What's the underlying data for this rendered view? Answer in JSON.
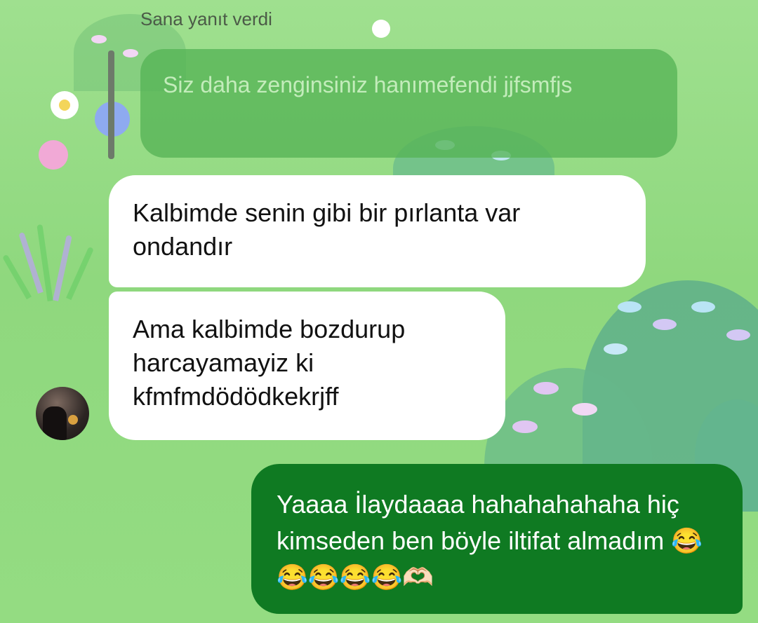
{
  "chat": {
    "reply_label": "Sana yanıt verdi",
    "quoted_message": "Siz daha zenginsiniz hanımefendi jjfsmfjs",
    "received": [
      "Kalbimde senin gibi bir pırlanta var ondandır",
      "Ama kalbimde bozdurup harcayamayiz ki kfmfmdödödkekrjff"
    ],
    "sent": "Yaaaa İlaydaaaa hahahahahaha hiç kimseden ben böyle iltifat almadım 😂😂😂😂😂🫶🏻"
  },
  "colors": {
    "background": "#94dc82",
    "sent_bubble": "#0f7a22",
    "received_bubble": "#ffffff",
    "quoted_bubble": "#56b456"
  }
}
